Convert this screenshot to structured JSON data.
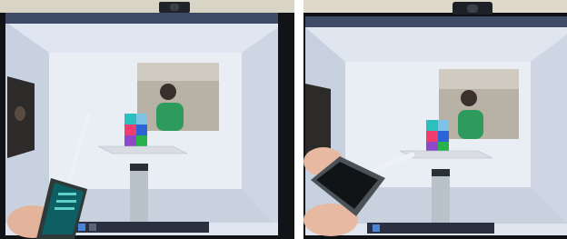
{
  "photos": [
    {
      "name": "left-photo",
      "screen_text": "",
      "colors": {
        "bezel": "#121317",
        "desk_wall": "#d7d3c6",
        "room_wall": "#b7c4d6",
        "screen_bg": "#dfe6f1",
        "floor": "#c9d2df",
        "shelf": "#d9dde3",
        "pillar": "#b9c1cb",
        "phone_body": "#2f3a38",
        "phone_screen": "#0d5f63",
        "pointer_beam": "#e8edf2",
        "hand": "#e4b39c"
      },
      "cube_colors": [
        "#2bbfbe",
        "#7cc3e6",
        "#ef3e6d",
        "#2c64d8",
        "#8e48c9",
        "#27b34a",
        "#f25a2c",
        "#f0d33a"
      ]
    },
    {
      "name": "right-photo",
      "screen_text": "",
      "colors": {
        "bezel": "#101114",
        "desk_wall": "#ded9cb",
        "room_wall": "#b8c4d4",
        "screen_bg": "#dfe6f0",
        "floor": "#c8d1dd",
        "shelf": "#d9dde3",
        "pillar": "#b9c1cb",
        "phone_body": "#4a5258",
        "phone_screen": "#111416",
        "pointer_beam": "#e8edf2",
        "hand": "#e7b9a0"
      },
      "cube_colors": [
        "#2bbfbe",
        "#7cc3e6",
        "#ef3e6d",
        "#2c64d8",
        "#8e48c9",
        "#27b34a",
        "#f25a2c",
        "#f0d33a"
      ]
    }
  ]
}
